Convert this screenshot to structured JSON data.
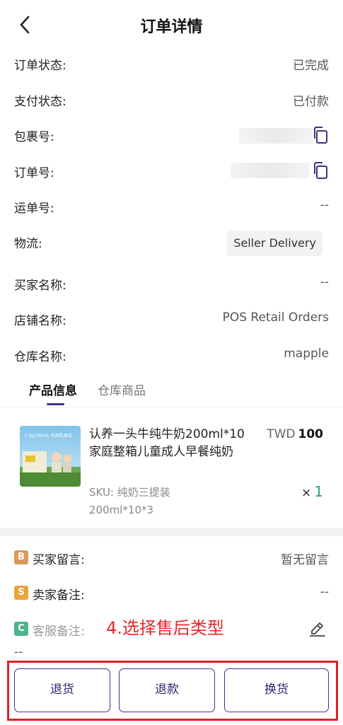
{
  "header": {
    "title": "订单详情"
  },
  "order": {
    "status_label": "订单状态:",
    "status_value": "已完成",
    "payment_label": "支付状态:",
    "payment_value": "已付款",
    "package_label": "包裹号:",
    "order_no_label": "订单号:",
    "waybill_label": "运单号:",
    "waybill_value": "--",
    "logistics_label": "物流:",
    "logistics_value": "Seller Delivery",
    "buyer_label": "买家名称:",
    "buyer_value": "--",
    "store_label": "店铺名称:",
    "store_value": "POS Retail Orders",
    "warehouse_label": "仓库名称:",
    "warehouse_value": "mapple"
  },
  "tabs": [
    {
      "label": "产品信息",
      "active": true
    },
    {
      "label": "仓库商品",
      "active": false
    }
  ],
  "product": {
    "name": "认养一头牛纯牛奶200ml*10家庭整箱儿童成人早餐纯奶",
    "sku": "SKU: 纯奶三提装200ml*10*3",
    "currency": "TWD",
    "price": "100",
    "qty_prefix": "×",
    "qty": "1",
    "thumb_caption": "3.3g/100mL 优质乳蛋白"
  },
  "notes": {
    "buyer_badge": "B",
    "buyer_label": "买家留言:",
    "buyer_value": "暂无留言",
    "seller_badge": "S",
    "seller_label": "卖家备注:",
    "seller_value": "--",
    "service_badge": "C",
    "service_label": "客服备注:",
    "service_value": "--"
  },
  "annotation": "4.选择售后类型",
  "actions": {
    "return": "退货",
    "refund": "退款",
    "exchange": "换货"
  },
  "colors": {
    "accent": "#3b3486",
    "annotation": "#e21f26",
    "qty": "#2aa06b",
    "badge_b": "#d99a5c",
    "badge_s": "#e9a43b",
    "badge_c": "#4bb58c"
  },
  "icons": {
    "back": "chevron-left-icon",
    "copy": "copy-icon",
    "edit": "edit-pen-icon"
  }
}
